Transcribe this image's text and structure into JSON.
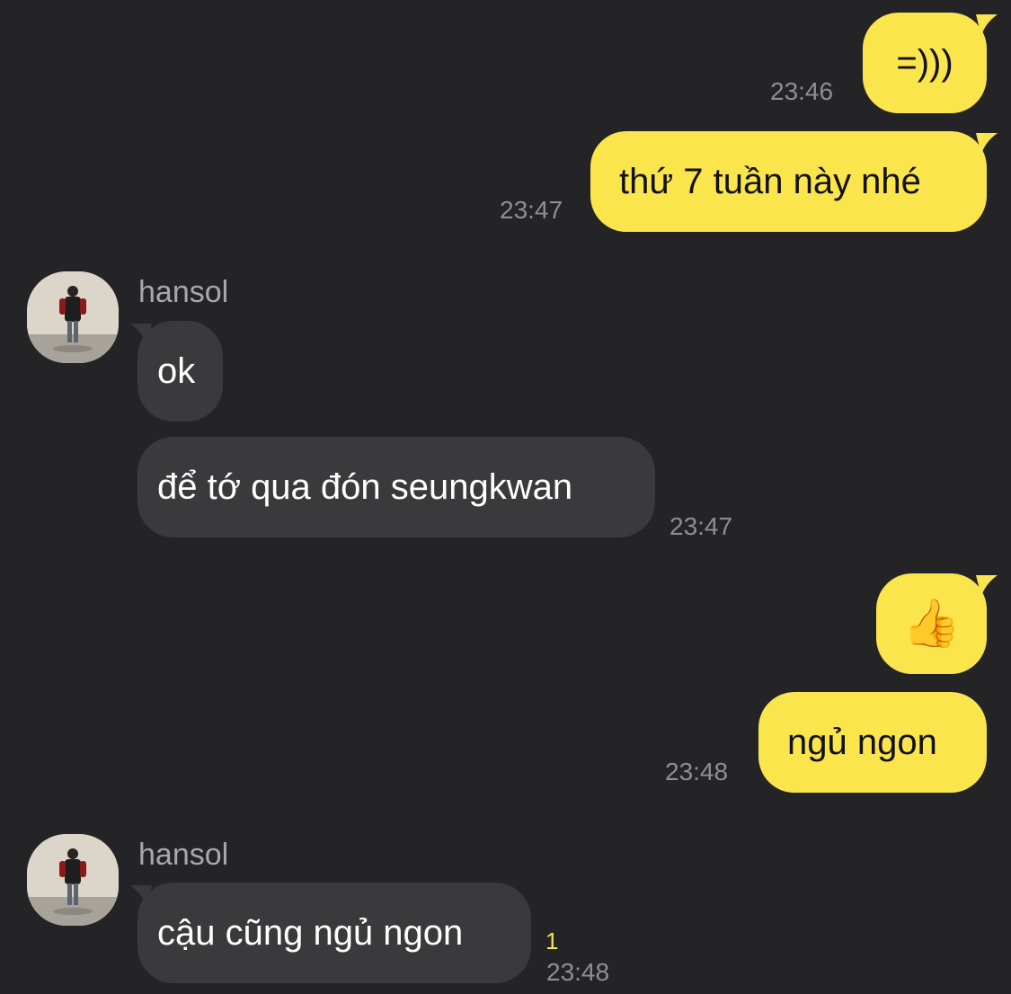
{
  "colors": {
    "background": "#242427",
    "outgoing_bubble": "#FBE54D",
    "incoming_bubble": "#3A3A3D",
    "timestamp": "#8E8E93",
    "unread_count": "#FBE54D"
  },
  "messages": [
    {
      "direction": "outgoing",
      "text": "=)))",
      "time": "23:46"
    },
    {
      "direction": "outgoing",
      "text": "thứ 7 tuần này nhé",
      "time": "23:47"
    },
    {
      "direction": "incoming",
      "sender": "hansol",
      "avatar": "user-avatar",
      "text": "ok"
    },
    {
      "direction": "incoming",
      "text": "để tớ qua đón seungkwan",
      "time": "23:47"
    },
    {
      "direction": "outgoing",
      "text": "👍",
      "icon": "thumbs-up-emoji"
    },
    {
      "direction": "outgoing",
      "text": "ngủ ngon",
      "time": "23:48"
    },
    {
      "direction": "incoming",
      "sender": "hansol",
      "avatar": "user-avatar",
      "text": "cậu cũng ngủ ngon",
      "unread": "1",
      "time": "23:48"
    }
  ]
}
